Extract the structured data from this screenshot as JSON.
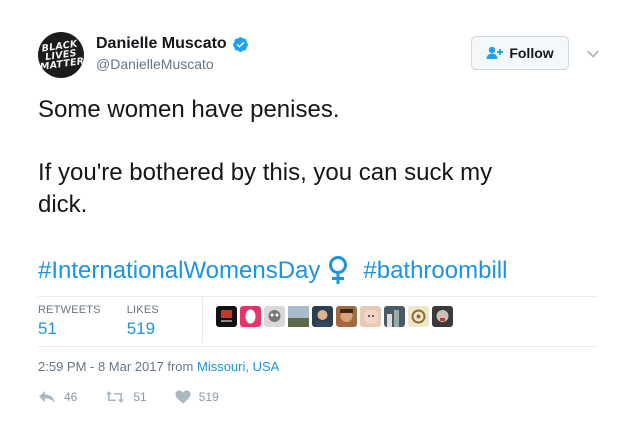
{
  "user": {
    "full_name": "Danielle Muscato",
    "handle": "@DanielleMuscato",
    "avatar_text": "BLACK LIVES MATTER",
    "verified": true
  },
  "follow_button": {
    "label": "Follow"
  },
  "tweet": {
    "line1": "Some women have penises.",
    "line2": "If you're bothered by this, you can suck my",
    "line3": "dick.",
    "hashtag1": "#InternationalWomensDay",
    "hashtag2": "#bathroombill"
  },
  "stats": {
    "retweets_label": "RETWEETS",
    "retweets_value": "51",
    "likes_label": "LIKES",
    "likes_value": "519"
  },
  "meta": {
    "timestamp": "2:59 PM - 8 Mar 2017",
    "from_word": "from",
    "location": "Missouri, USA"
  },
  "actions": {
    "reply_count": "46",
    "retweet_count": "51",
    "like_count": "519"
  },
  "colors": {
    "link": "#1b95e0",
    "verified": "#1da1f2",
    "muted": "#657786"
  }
}
